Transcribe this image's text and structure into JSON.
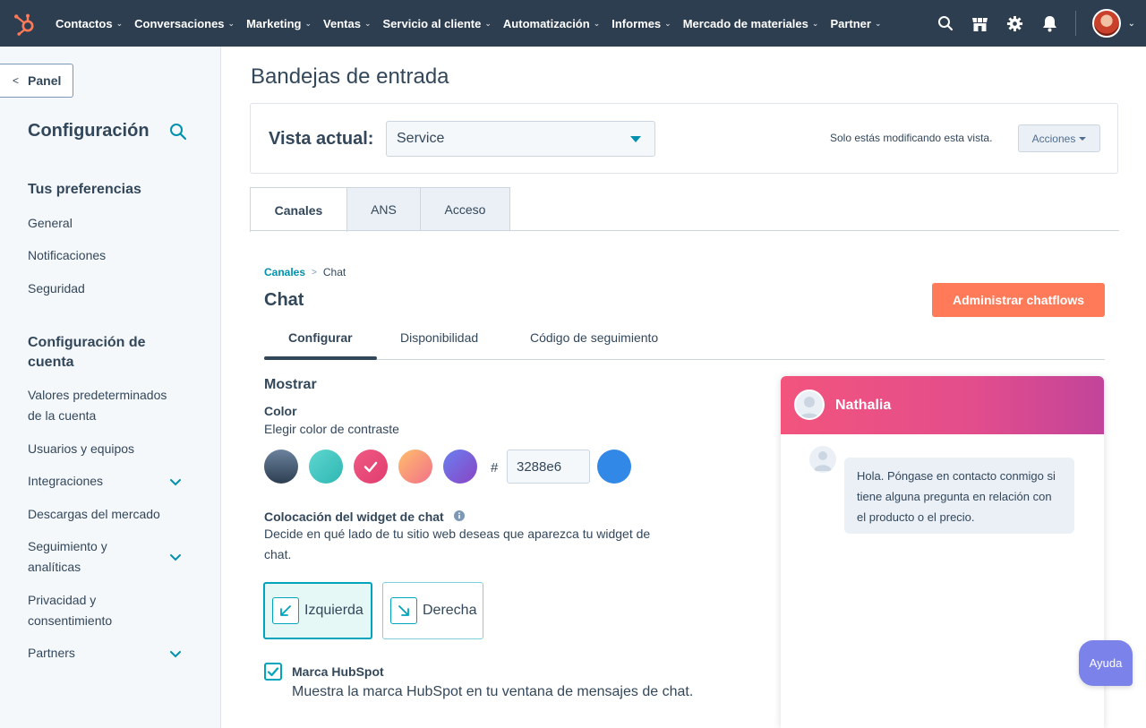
{
  "topnav": {
    "items": [
      {
        "label": "Contactos"
      },
      {
        "label": "Conversaciones"
      },
      {
        "label": "Marketing"
      },
      {
        "label": "Ventas"
      },
      {
        "label": "Servicio al cliente"
      },
      {
        "label": "Automatización"
      },
      {
        "label": "Informes"
      },
      {
        "label": "Mercado de materiales"
      },
      {
        "label": "Partner"
      }
    ],
    "icons": [
      "search-icon",
      "marketplace-icon",
      "gear-icon",
      "bell-icon"
    ],
    "bg_color": "#2d3e50",
    "logo_color": "#ff7a59"
  },
  "sidebar": {
    "back_label": "Panel",
    "title": "Configuración",
    "section1": {
      "heading": "Tus preferencias",
      "items": [
        "General",
        "Notificaciones",
        "Seguridad"
      ]
    },
    "section2": {
      "heading": "Configuración de cuenta",
      "items": [
        "Valores predeterminados de la cuenta",
        "Usuarios y equipos",
        "Integraciones",
        "Descargas del mercado",
        "Seguimiento y analíticas",
        "Privacidad y consentimiento",
        "Partners"
      ]
    }
  },
  "main": {
    "page_title": "Bandejas de entrada",
    "view": {
      "label": "Vista actual:",
      "selected": "Service",
      "note": "Solo estás modificando esta vista.",
      "actions_label": "Acciones"
    },
    "tabs": [
      {
        "label": "Canales",
        "active": true
      },
      {
        "label": "ANS",
        "active": false
      },
      {
        "label": "Acceso",
        "active": false
      }
    ],
    "breadcrumb": {
      "parent": "Canales",
      "current": "Chat"
    },
    "chat_title": "Chat",
    "manage_button": "Administrar chatflows",
    "subtabs": [
      {
        "label": "Configurar",
        "active": true
      },
      {
        "label": "Disponibilidad",
        "active": false
      },
      {
        "label": "Código de seguimiento",
        "active": false
      }
    ],
    "display": {
      "section_title": "Mostrar",
      "color_label": "Color",
      "color_help": "Elegir color de contraste",
      "swatches": [
        {
          "name": "dark-slate",
          "from": "#6b829e",
          "to": "#2d3e50"
        },
        {
          "name": "teal",
          "from": "#5fd6d0",
          "to": "#2eb7b3"
        },
        {
          "name": "pink",
          "from": "#f05a84",
          "to": "#e03d6e",
          "selected": true
        },
        {
          "name": "orange",
          "from": "#ffbe6b",
          "to": "#f2708a"
        },
        {
          "name": "purple",
          "from": "#6a7ff0",
          "to": "#8a44c4"
        }
      ],
      "hex_symbol": "#",
      "hex_value": "3288e6",
      "custom_color": "#3288e6",
      "placement_label": "Colocación del widget de chat",
      "placement_help": "Decide en qué lado de tu sitio web deseas que aparezca tu widget de chat.",
      "placement_options": [
        {
          "label": "Izquierda",
          "selected": true
        },
        {
          "label": "Derecha",
          "selected": false
        }
      ],
      "branding_checked": true,
      "branding_label": "Marca HubSpot",
      "branding_help": "Muestra la marca HubSpot en tu ventana de mensajes de chat."
    }
  },
  "preview": {
    "agent_name": "Nathalia",
    "message": "Hola. Póngase en contacto conmigo si tiene alguna pregunta en relación con el producto o el precio."
  },
  "help_button": "Ayuda",
  "colors": {
    "accent": "#00a4bd",
    "link": "#0091ae",
    "primary_button": "#ff7a59",
    "text": "#33475b"
  }
}
